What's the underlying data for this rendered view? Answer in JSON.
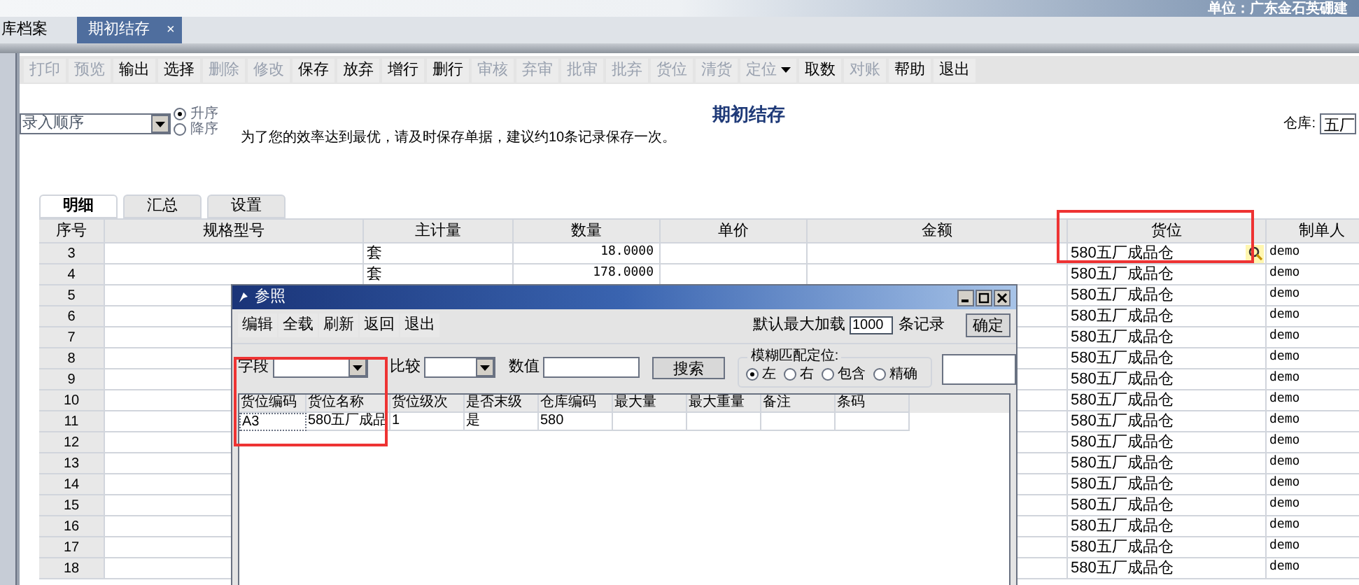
{
  "header": {
    "text": "单位：广东金石英硼建"
  },
  "tabs": [
    {
      "label": "库档案",
      "selected": false
    },
    {
      "label": "期初结存",
      "selected": true,
      "close": "×"
    }
  ],
  "toolbar": [
    {
      "label": "打印",
      "disabled": true
    },
    {
      "label": "预览",
      "disabled": true
    },
    {
      "label": "输出",
      "disabled": false
    },
    {
      "label": "选择",
      "disabled": false
    },
    {
      "label": "删除",
      "disabled": true
    },
    {
      "label": "修改",
      "disabled": true
    },
    {
      "label": "保存",
      "disabled": false
    },
    {
      "label": "放弃",
      "disabled": false
    },
    {
      "label": "增行",
      "disabled": false
    },
    {
      "label": "删行",
      "disabled": false
    },
    {
      "label": "审核",
      "disabled": true
    },
    {
      "label": "弃审",
      "disabled": true
    },
    {
      "label": "批审",
      "disabled": true
    },
    {
      "label": "批弃",
      "disabled": true
    },
    {
      "label": "货位",
      "disabled": true
    },
    {
      "label": "清货",
      "disabled": true
    },
    {
      "label": "定位",
      "disabled": true,
      "dropdown": true
    },
    {
      "label": "取数",
      "disabled": false
    },
    {
      "label": "对账",
      "disabled": true
    },
    {
      "label": "帮助",
      "disabled": false
    },
    {
      "label": "退出",
      "disabled": false
    }
  ],
  "sort": {
    "value": "录入顺序",
    "options": [
      {
        "label": "升序",
        "selected": true
      },
      {
        "label": "降序",
        "selected": false
      }
    ]
  },
  "title": "期初结存",
  "notice": "为了您的效率达到最优，请及时保存单据，建议约10条记录保存一次。",
  "warehouse": {
    "label": "仓库:",
    "value": "五厂"
  },
  "sheet_tabs": [
    {
      "label": "明细",
      "selected": true
    },
    {
      "label": "汇总",
      "selected": false
    },
    {
      "label": "设置",
      "selected": false
    }
  ],
  "table": {
    "columns": [
      "序号",
      "规格型号",
      "主计量",
      "数量",
      "单价",
      "金额",
      "货位",
      "制单人"
    ],
    "rows": [
      {
        "no": "3",
        "unit": "套",
        "qty": "18.0000",
        "location": "580五厂成品仓",
        "creator": "demo",
        "editing": true
      },
      {
        "no": "4",
        "unit": "套",
        "qty": "178.0000",
        "location": "580五厂成品仓",
        "creator": "demo",
        "editing": false
      },
      {
        "no": "5",
        "location": "580五厂成品仓",
        "creator": "demo",
        "editing": false
      },
      {
        "no": "6",
        "location": "580五厂成品仓",
        "creator": "demo",
        "editing": false
      },
      {
        "no": "7",
        "location": "580五厂成品仓",
        "creator": "demo",
        "editing": false
      },
      {
        "no": "8",
        "location": "580五厂成品仓",
        "creator": "demo",
        "editing": false
      },
      {
        "no": "9",
        "location": "580五厂成品仓",
        "creator": "demo",
        "editing": false
      },
      {
        "no": "10",
        "location": "580五厂成品仓",
        "creator": "demo",
        "editing": false
      },
      {
        "no": "11",
        "location": "580五厂成品仓",
        "creator": "demo",
        "editing": false
      },
      {
        "no": "12",
        "location": "580五厂成品仓",
        "creator": "demo",
        "editing": false
      },
      {
        "no": "13",
        "location": "580五厂成品仓",
        "creator": "demo",
        "editing": false
      },
      {
        "no": "14",
        "location": "580五厂成品仓",
        "creator": "demo",
        "editing": false
      },
      {
        "no": "15",
        "location": "580五厂成品仓",
        "creator": "demo",
        "editing": false
      },
      {
        "no": "16",
        "location": "580五厂成品仓",
        "creator": "demo",
        "editing": false
      },
      {
        "no": "17",
        "location": "580五厂成品仓",
        "creator": "demo",
        "editing": false
      },
      {
        "no": "18",
        "location": "580五厂成品仓",
        "creator": "demo",
        "editing": false
      }
    ]
  },
  "dialog": {
    "title": "参照",
    "menu": [
      "编辑",
      "全载",
      "刷新",
      "返回",
      "退出"
    ],
    "max_load_label": "默认最大加载",
    "max_load": "1000",
    "records_label": "条记录",
    "ok": "确定",
    "filter": {
      "field_label": "字段",
      "compare_label": "比较",
      "value_label": "数值",
      "search": "搜索"
    },
    "fuzzy": {
      "label": "模糊匹配定位:",
      "options": [
        {
          "label": "左",
          "selected": true
        },
        {
          "label": "右",
          "selected": false
        },
        {
          "label": "包含",
          "selected": false
        },
        {
          "label": "精确",
          "selected": false
        }
      ]
    },
    "grid": {
      "columns": [
        "货位编码",
        "货位名称",
        "货位级次",
        "是否末级",
        "仓库编码",
        "最大量",
        "最大重量",
        "备注",
        "条码"
      ],
      "rows": [
        {
          "cells": [
            "A3",
            "580五厂成品",
            "1",
            "是",
            "580"
          ]
        }
      ]
    }
  }
}
